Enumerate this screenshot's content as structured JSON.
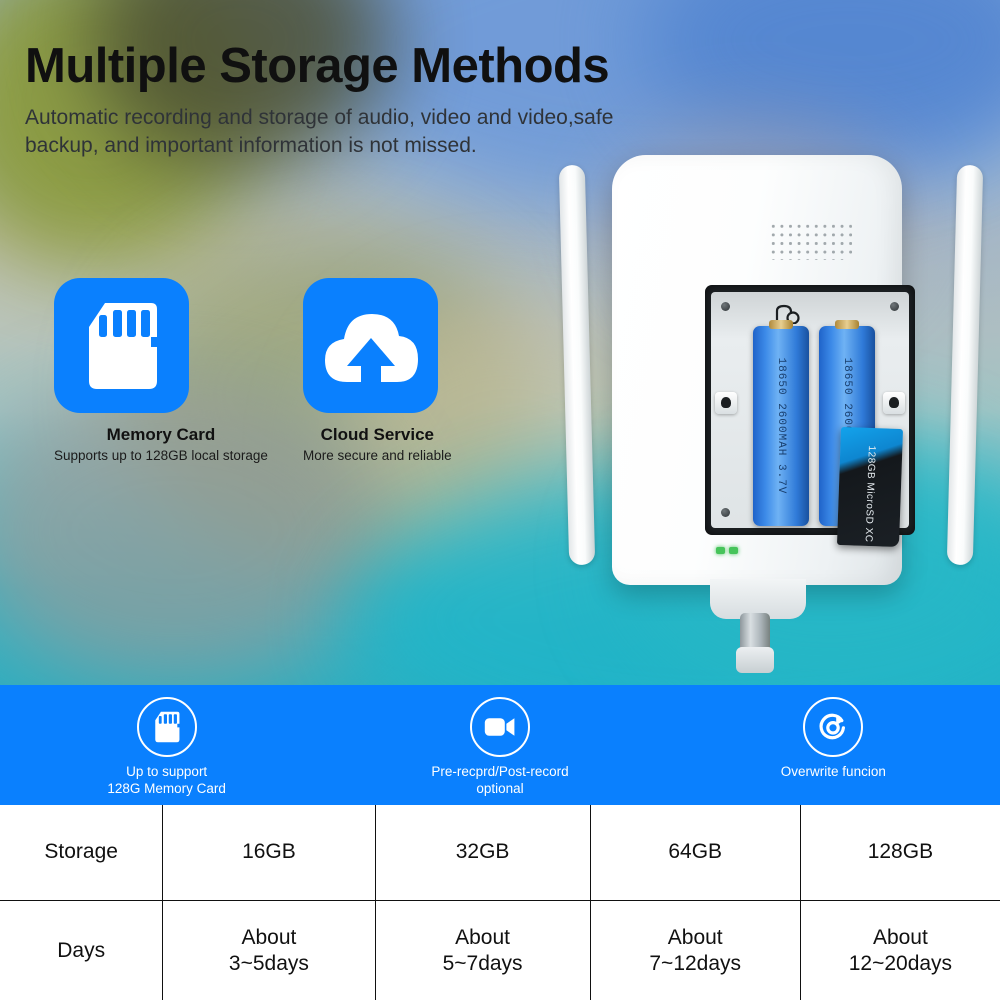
{
  "header": {
    "title": "Multiple Storage Methods",
    "subtitle": "Automatic recording and storage of audio, video and video,safe backup, and important information is not missed."
  },
  "colors": {
    "brand_blue": "#0a80fe",
    "tile_blue": "#0a80fe",
    "text_dark": "#111111",
    "banner_text": "#ffffff"
  },
  "features": [
    {
      "icon": "sd-card-icon",
      "title": "Memory Card",
      "subtitle": "Supports up to 128GB local storage"
    },
    {
      "icon": "cloud-upload-icon",
      "title": "Cloud Service",
      "subtitle": "More secure and reliable"
    }
  ],
  "device": {
    "name": "wifi-security-camera",
    "battery_label": "18650 2600MAH 3.7V",
    "sd_label": "128GB MicroSD XC",
    "battery_count": 2
  },
  "banner": {
    "items": [
      {
        "icon": "sd-card-icon",
        "line1": "Up to support",
        "line2": "128G Memory Card"
      },
      {
        "icon": "video-camera-icon",
        "line1": "Pre-recprd/Post-record",
        "line2": "optional"
      },
      {
        "icon": "overwrite-icon",
        "line1": "Overwrite funcion",
        "line2": ""
      }
    ]
  },
  "table": {
    "rows": [
      {
        "label": "Storage",
        "cells": [
          "16GB",
          "32GB",
          "64GB",
          "128GB"
        ]
      },
      {
        "label": "Days",
        "cells_line1": [
          "About",
          "About",
          "About",
          "About"
        ],
        "cells_line2": [
          "3~5days",
          "5~7days",
          "7~12days",
          "12~20days"
        ]
      }
    ]
  }
}
